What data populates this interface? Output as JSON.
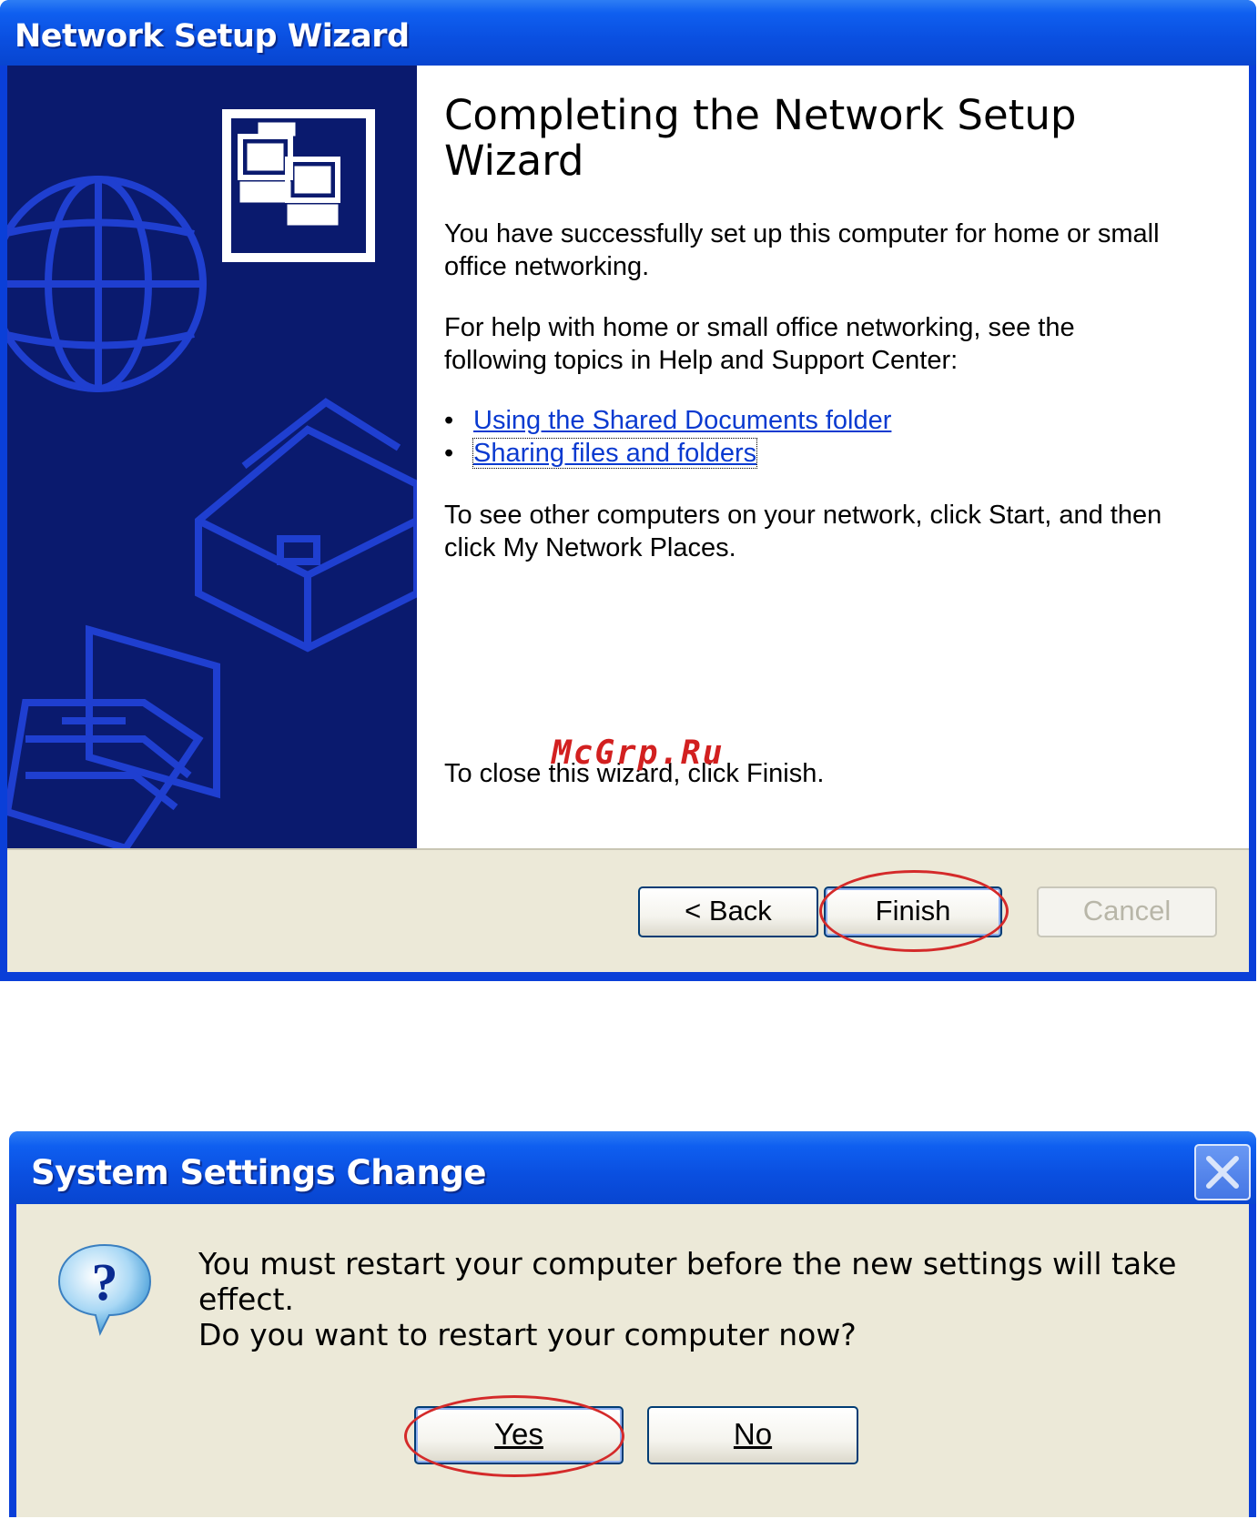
{
  "wizard": {
    "title": "Network Setup Wizard",
    "heading": "Completing the Network Setup Wizard",
    "para1": "You have successfully set up this computer for home or small office networking.",
    "para2": "For help with home or small office networking, see the following topics in Help and Support Center:",
    "links": [
      "Using the Shared Documents folder",
      "Sharing files and folders"
    ],
    "para3": "To see other computers on your network, click Start, and then click My Network Places.",
    "para4": "To close this wizard, click Finish.",
    "watermark": "McGrp.Ru",
    "buttons": {
      "back": "< Back",
      "finish": "Finish",
      "cancel": "Cancel"
    }
  },
  "dialog": {
    "title": "System Settings Change",
    "message": "You must restart your computer before the new settings will take effect.",
    "question": "Do you want to restart your computer now?",
    "buttons": {
      "yes": "Yes",
      "no": "No"
    }
  },
  "colors": {
    "titlebar": "#0a4fe0",
    "sidebar": "#0a1a6e",
    "dialog_bg": "#ece9d8",
    "highlight": "#d42a2a"
  }
}
